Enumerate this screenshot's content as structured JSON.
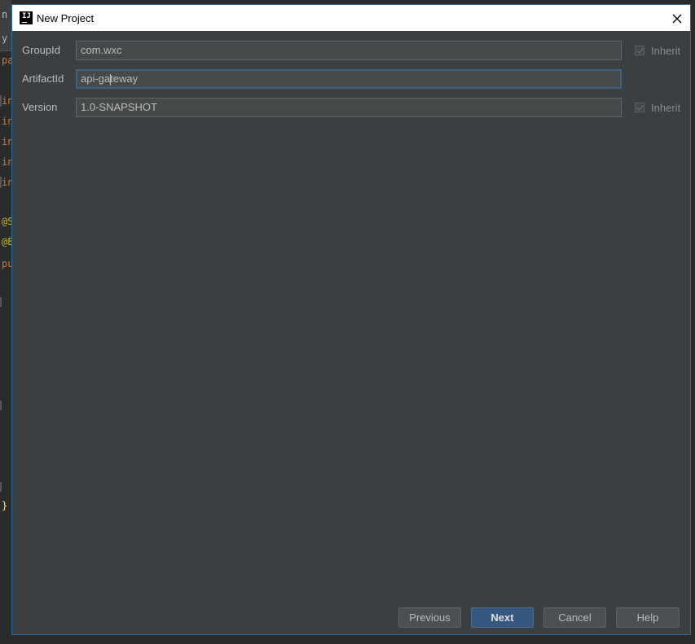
{
  "editor": {
    "lines": [
      "n",
      "y",
      "pa",
      "in",
      "in",
      "in",
      "in",
      "in",
      "@S",
      "@E",
      "pu",
      "}"
    ]
  },
  "dialog": {
    "title": "New Project",
    "fields": {
      "group_id": {
        "label": "GroupId",
        "value": "com.wxc",
        "inherit_label": "Inherit"
      },
      "artifact_id": {
        "label": "ArtifactId",
        "value_before_caret": "api-ga",
        "value_after_caret": "teway"
      },
      "version": {
        "label": "Version",
        "value": "1.0-SNAPSHOT",
        "inherit_label": "Inherit"
      }
    },
    "buttons": {
      "previous": "Previous",
      "next": "Next",
      "cancel": "Cancel",
      "help": "Help"
    }
  },
  "colors": {
    "dialog_bg": "#3c3f41",
    "field_bg": "#45494a",
    "primary_button": "#365880",
    "focus_border": "#3d6185"
  }
}
